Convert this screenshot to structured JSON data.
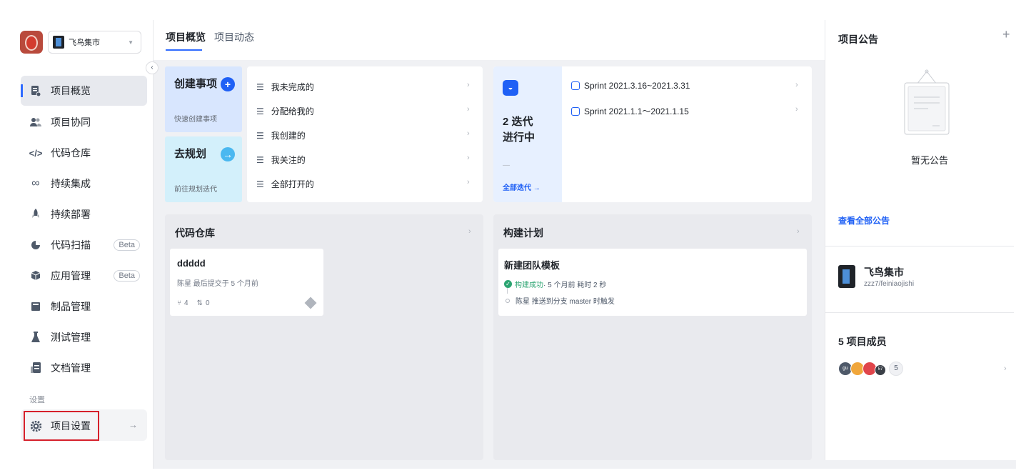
{
  "project": {
    "name": "飞鸟集市",
    "path": "zzz7/feiniaojishi"
  },
  "sidebar": {
    "items": [
      {
        "label": "项目概览",
        "icon": "overview-icon"
      },
      {
        "label": "项目协同",
        "icon": "team-icon"
      },
      {
        "label": "代码仓库",
        "icon": "code-icon"
      },
      {
        "label": "持续集成",
        "icon": "infinity-icon"
      },
      {
        "label": "持续部署",
        "icon": "rocket-icon"
      },
      {
        "label": "代码扫描",
        "icon": "scan-icon",
        "badge": "Beta"
      },
      {
        "label": "应用管理",
        "icon": "cube-icon",
        "badge": "Beta"
      },
      {
        "label": "制品管理",
        "icon": "package-icon"
      },
      {
        "label": "测试管理",
        "icon": "flask-icon"
      },
      {
        "label": "文档管理",
        "icon": "doc-icon"
      }
    ],
    "group_label": "设置",
    "settings_label": "项目设置"
  },
  "tabs": [
    "项目概览",
    "项目动态"
  ],
  "quick": {
    "create_title": "创建事项",
    "create_sub": "快速创建事项",
    "plan_title": "去规划",
    "plan_sub": "前往规划迭代"
  },
  "filters": [
    "我未完成的",
    "分配给我的",
    "我创建的",
    "我关注的",
    "全部打开的"
  ],
  "sprint": {
    "count_line1": "2 迭代",
    "count_line2": "进行中",
    "dash": "—",
    "all_link": "全部迭代 →",
    "rows": [
      "Sprint 2021.3.16~2021.3.31",
      "Sprint 2021.1.1～2021.1.15"
    ]
  },
  "repo": {
    "title": "代码仓库",
    "name": "ddddd",
    "meta": "陈星 最后提交于 5 个月前",
    "branches": "4",
    "merges": "0"
  },
  "build": {
    "title": "构建计划",
    "name": "新建团队模板",
    "status": "构建成功",
    "meta": " · 5 个月前  耗时 2 秒",
    "trigger": "陈星 推送到分支 master 时触发"
  },
  "notice": {
    "title": "项目公告",
    "add": "+",
    "empty": "暂无公告",
    "link": "查看全部公告"
  },
  "members": {
    "title": "5 项目成员",
    "count": "5",
    "avatars": [
      "gu",
      "",
      "",
      "57"
    ]
  },
  "colors": {
    "accent": "#2f6bff",
    "success": "#2ba471",
    "highlight": "#d6202b",
    "quick_blue": "#d8e6fe",
    "quick_cyan": "#d3f0fb"
  }
}
